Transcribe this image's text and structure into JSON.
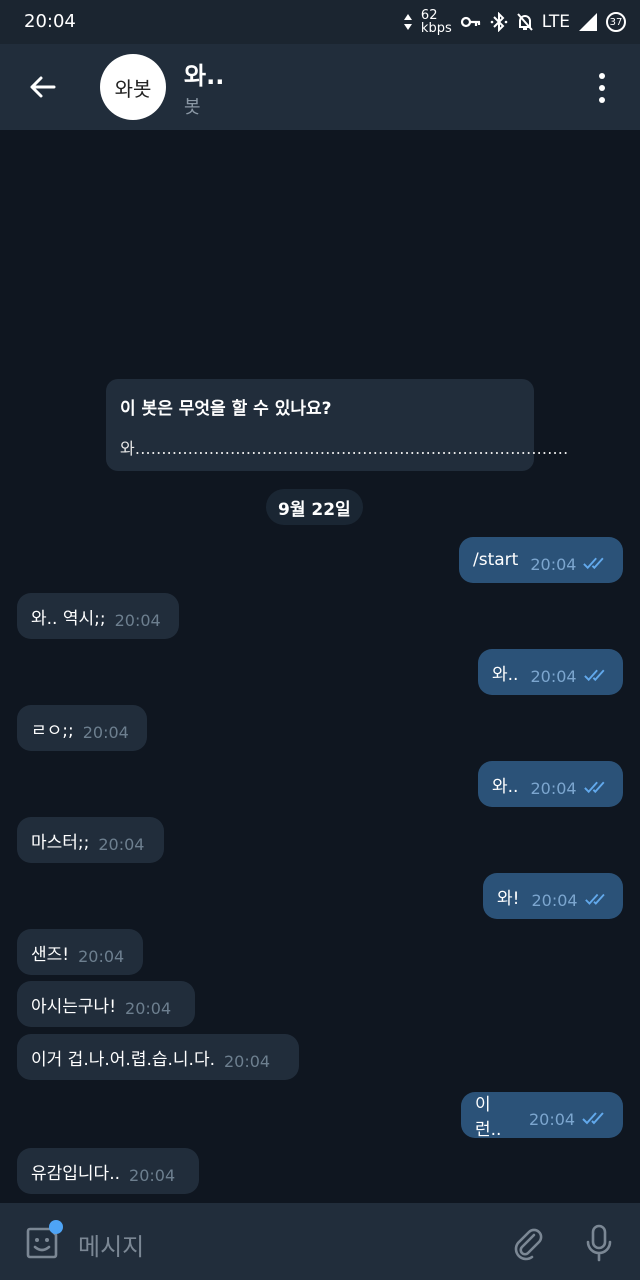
{
  "status_bar": {
    "time": "20:04",
    "speed_value": "62",
    "speed_unit": "kbps",
    "network": "LTE",
    "battery": "37"
  },
  "header": {
    "title": "와..",
    "subtitle": "봇",
    "avatar_text": "와봇"
  },
  "bot_info": {
    "title": "이 봇은 무엇을 할 수 있나요?",
    "body": "와.................................................................................."
  },
  "date_chip": "9월 22일",
  "messages": [
    {
      "text": "/start",
      "time": "20:04",
      "outgoing": true
    },
    {
      "text": "와.. 역시;;",
      "time": "20:04",
      "outgoing": false
    },
    {
      "text": "와..",
      "time": "20:04",
      "outgoing": true
    },
    {
      "text": "ㄹㅇ;;",
      "time": "20:04",
      "outgoing": false
    },
    {
      "text": "와..",
      "time": "20:04",
      "outgoing": true
    },
    {
      "text": "마스터;;",
      "time": "20:04",
      "outgoing": false
    },
    {
      "text": "와!",
      "time": "20:04",
      "outgoing": true
    },
    {
      "text": "샌즈!",
      "time": "20:04",
      "outgoing": false
    },
    {
      "text": "아시는구나!",
      "time": "20:04",
      "outgoing": false
    },
    {
      "text": "이거 겁.나.어.렵.습.니.다.",
      "time": "20:04",
      "outgoing": false
    },
    {
      "text": "이런..",
      "time": "20:04",
      "outgoing": true
    },
    {
      "text": "유감입니다..",
      "time": "20:04",
      "outgoing": false
    }
  ],
  "input": {
    "placeholder": "메시지"
  },
  "icons": {
    "back": "back-arrow-icon",
    "menu": "more-vertical-icon",
    "emoji": "sticker-icon",
    "attach": "paperclip-icon",
    "mic": "microphone-icon",
    "read": "double-check-icon"
  },
  "colors": {
    "background": "#0f1620",
    "header": "#212d3b",
    "incoming_bubble": "#212d3b",
    "outgoing_bubble": "#2b5278",
    "read_ticks": "#62a9ec"
  }
}
